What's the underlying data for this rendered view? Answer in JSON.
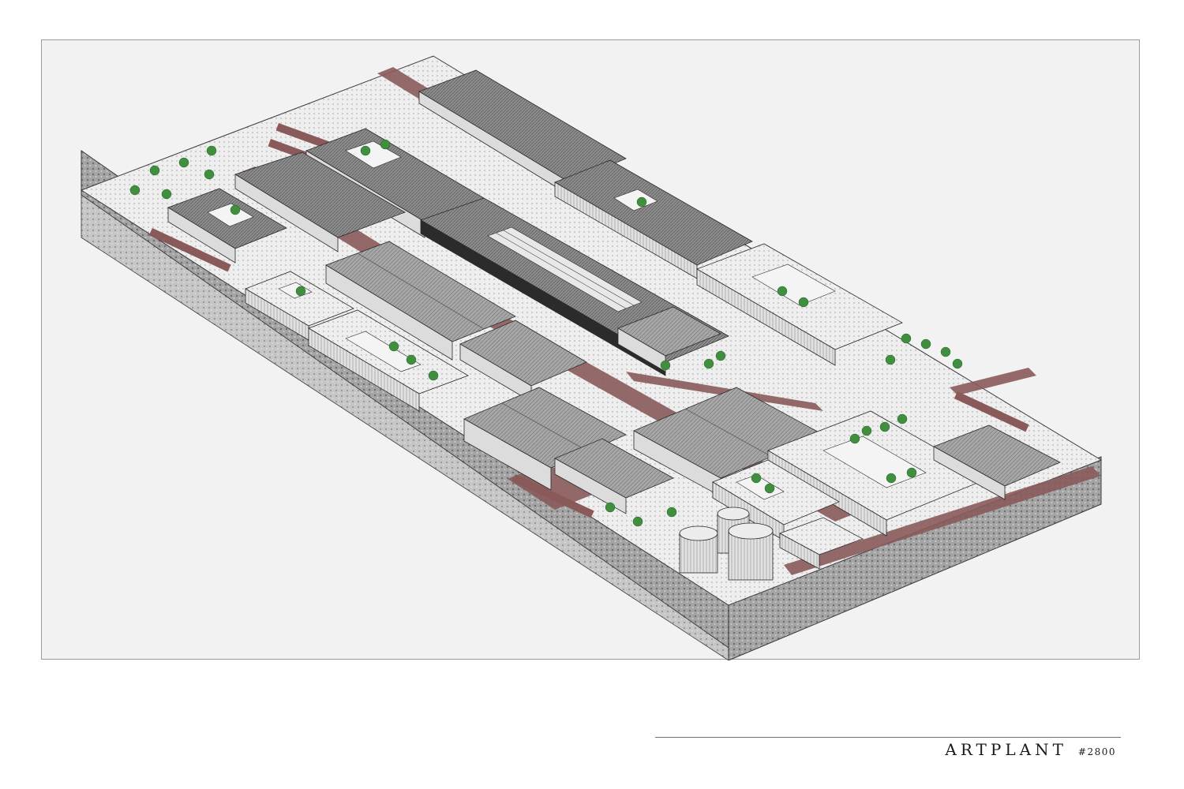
{
  "title_block": {
    "project_name": "ARTPLANT",
    "project_number": "#2800"
  },
  "colors": {
    "frame_background": "#f2f2f2",
    "site_top": "#f4f4f4",
    "roof_dark": "#8e8e8e",
    "roof_medium": "#a9a9a9",
    "roof_light": "#e6e6e6",
    "wall": "#dcdcdc",
    "path": "#8a5a5a",
    "tree": "#3f8f3f",
    "ground_section": "#9a9a9a",
    "ink": "#2b2b2b"
  }
}
